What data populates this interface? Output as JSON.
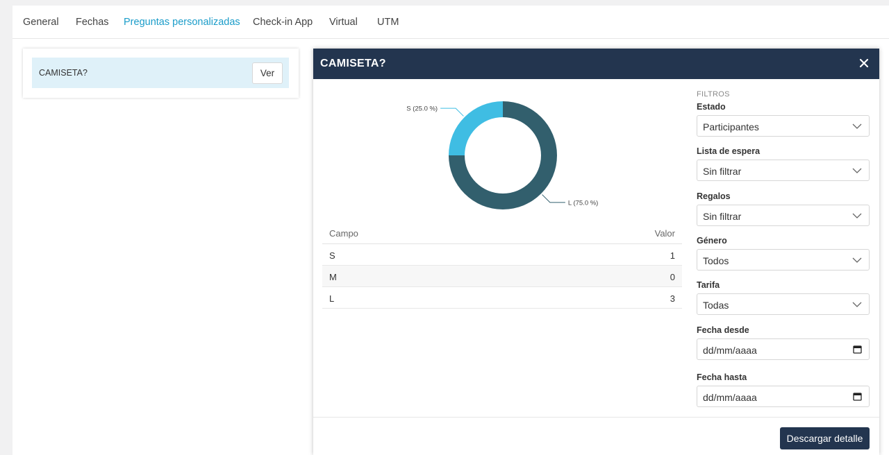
{
  "tabs": [
    {
      "label": "General"
    },
    {
      "label": "Fechas"
    },
    {
      "label": "Preguntas personalizadas",
      "active": true
    },
    {
      "label": "Check-in App"
    },
    {
      "label": "Virtual"
    },
    {
      "label": "UTM"
    }
  ],
  "question_card": {
    "label": "CAMISETA?",
    "button": "Ver"
  },
  "modal": {
    "title": "CAMISETA?",
    "close_icon": "close-icon",
    "table": {
      "headers": [
        "Campo",
        "Valor"
      ],
      "rows": [
        {
          "campo": "S",
          "valor": "1"
        },
        {
          "campo": "M",
          "valor": "0"
        },
        {
          "campo": "L",
          "valor": "3"
        }
      ]
    },
    "filters": {
      "title": "FILTROS",
      "estado": {
        "label": "Estado",
        "value": "Participantes"
      },
      "lista_espera": {
        "label": "Lista de espera",
        "value": "Sin filtrar"
      },
      "regalos": {
        "label": "Regalos",
        "value": "Sin filtrar"
      },
      "genero": {
        "label": "Género",
        "value": "Todos"
      },
      "tarifa": {
        "label": "Tarifa",
        "value": "Todas"
      },
      "fecha_desde": {
        "label": "Fecha desde",
        "placeholder": "dd/mm/aaaa"
      },
      "fecha_hasta": {
        "label": "Fecha hasta",
        "placeholder": "dd/mm/aaaa"
      }
    },
    "download_button": "Descargar detalle"
  },
  "chart_data": {
    "type": "pie",
    "donut": true,
    "slices": [
      {
        "label": "S",
        "value": 25.0,
        "display": "S (25.0 %)",
        "color": "#3fbde3"
      },
      {
        "label": "L",
        "value": 75.0,
        "display": "L (75.0 %)",
        "color": "#325f6d"
      }
    ]
  },
  "colors": {
    "accent": "#1a9cc9",
    "header": "#23354f",
    "highlight": "#dff1f9"
  }
}
